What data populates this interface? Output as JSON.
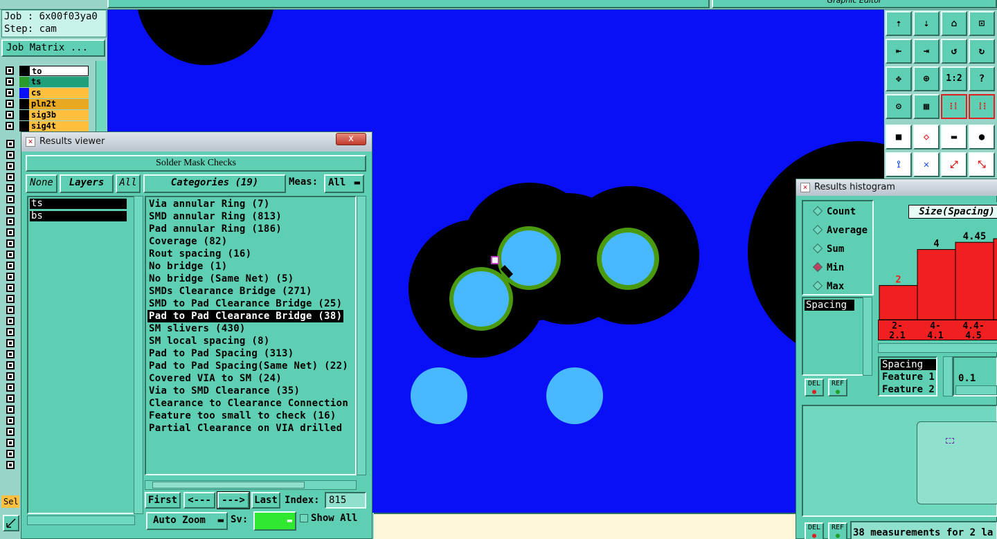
{
  "header": {
    "job": "Job : 6x00f03ya0",
    "step": "Step: cam",
    "job_matrix": "Job Matrix ...",
    "graphic_editor": "Graphic Editor"
  },
  "layers": [
    {
      "name": "to",
      "color": "#ffffff"
    },
    {
      "name": "ts",
      "color": "#1fa07a"
    },
    {
      "name": "cs",
      "color": "#ffc040"
    },
    {
      "name": "pln2t",
      "color": "#ffc040"
    },
    {
      "name": "sig3b",
      "color": "#ffc040"
    },
    {
      "name": "sig4t",
      "color": "#ffc040"
    }
  ],
  "layer_swatches": [
    "#000000",
    "#2a9a2a",
    "#0a10f5",
    "#000000",
    "#000000",
    "#000000"
  ],
  "sel_label": "Sel",
  "results_viewer": {
    "title": "Results viewer",
    "close": "x",
    "check_title": "Solder Mask Checks",
    "none_btn": "None",
    "layers_btn": "Layers",
    "all_btn": "All",
    "categories_btn": "Categories (19)",
    "meas_label": "Meas:",
    "meas_value": "All",
    "layer_items": [
      "ts",
      "bs"
    ],
    "categories": [
      "Via annular Ring (7)",
      "SMD annular Ring (813)",
      "Pad annular Ring (186)",
      "Coverage (82)",
      "Rout spacing (16)",
      "No bridge (1)",
      "No bridge (Same Net) (5)",
      "SMDs Clearance Bridge (271)",
      "SMD to Pad Clearance Bridge (25)",
      "Pad to Pad Clearance Bridge (38)",
      "SM slivers (430)",
      "SM local spacing (8)",
      "Pad to Pad Spacing (313)",
      "Pad to Pad Spacing(Same Net) (22)",
      "Covered VIA to SM (24)",
      "Via to SMD Clearance (35)",
      "Clearance to Clearance Connection",
      "Feature too small to check (16)",
      "Partial Clearance on VIA drilled"
    ],
    "selected_index": 9,
    "first": "First",
    "prev": "<---",
    "next": "--->",
    "last": "Last",
    "index_label": "Index:",
    "index_value": "815",
    "auto_zoom": "Auto Zoom",
    "sv_label": "Sv:",
    "show_all": "Show All"
  },
  "histogram": {
    "title": "Results histogram",
    "options": [
      "Count",
      "Average",
      "Sum",
      "Min",
      "Max"
    ],
    "selected_option": "Min",
    "list_item": "Spacing",
    "del": "DEL",
    "ref": "REF",
    "chart_title": "Size(Spacing)",
    "bar_labels": [
      "2",
      "4",
      "4.45"
    ],
    "x_labels": [
      "2-\n2.1",
      "4-\n4.1",
      "4.4-\n4.5"
    ],
    "fields": [
      "Spacing",
      "Feature 1",
      "Feature 2"
    ],
    "slider_value": "0.1",
    "status": "38 measurements for 2 la"
  },
  "colors": {
    "canvas": "#0a10f5",
    "pad": "#48b8ff",
    "annular": "#4a9a10",
    "clearance": "#000000",
    "panel": "#5ecfb2",
    "bar": "#f02020"
  }
}
